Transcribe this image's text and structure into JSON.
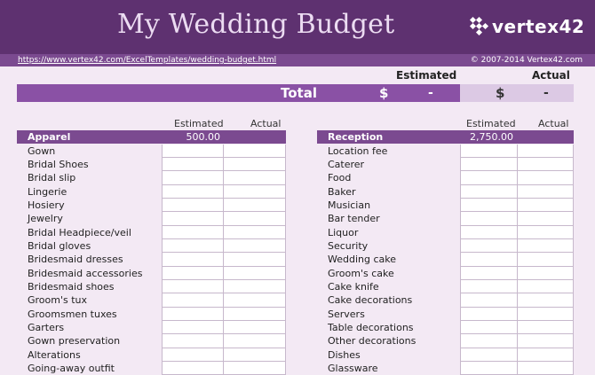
{
  "header": {
    "title": "My Wedding Budget",
    "brand": "vertex42",
    "url": "https://www.vertex42.com/ExcelTemplates/wedding-budget.html",
    "copyright": "© 2007-2014 Vertex42.com"
  },
  "summary": {
    "estimated_label": "Estimated",
    "actual_label": "Actual",
    "total_label": "Total",
    "currency": "$",
    "estimated_value": "-",
    "actual_value": "-"
  },
  "columns": {
    "estimated": "Estimated",
    "actual": "Actual"
  },
  "apparel": {
    "name": "Apparel",
    "estimated_total": "500.00",
    "items": [
      "Gown",
      "Bridal Shoes",
      "Bridal slip",
      "Lingerie",
      "Hosiery",
      "Jewelry",
      "Bridal Headpiece/veil",
      "Bridal gloves",
      "Bridesmaid dresses",
      "Bridesmaid accessories",
      "Bridesmaid shoes",
      "Groom's tux",
      "Groomsmen tuxes",
      "Garters",
      "Gown preservation",
      "Alterations",
      "Going-away outfit"
    ]
  },
  "reception": {
    "name": "Reception",
    "estimated_total": "2,750.00",
    "items": [
      "Location fee",
      "Caterer",
      "Food",
      "Baker",
      "Musician",
      "Bar tender",
      "Liquor",
      "Security",
      "Wedding cake",
      "Groom's cake",
      "Cake knife",
      "Cake decorations",
      "Servers",
      "Table decorations",
      "Other decorations",
      "Dishes",
      "Glassware"
    ]
  },
  "colors": {
    "banner": "#5e3170",
    "accent": "#8a51a5",
    "section": "#7b4a90",
    "background": "#f3e9f4"
  }
}
